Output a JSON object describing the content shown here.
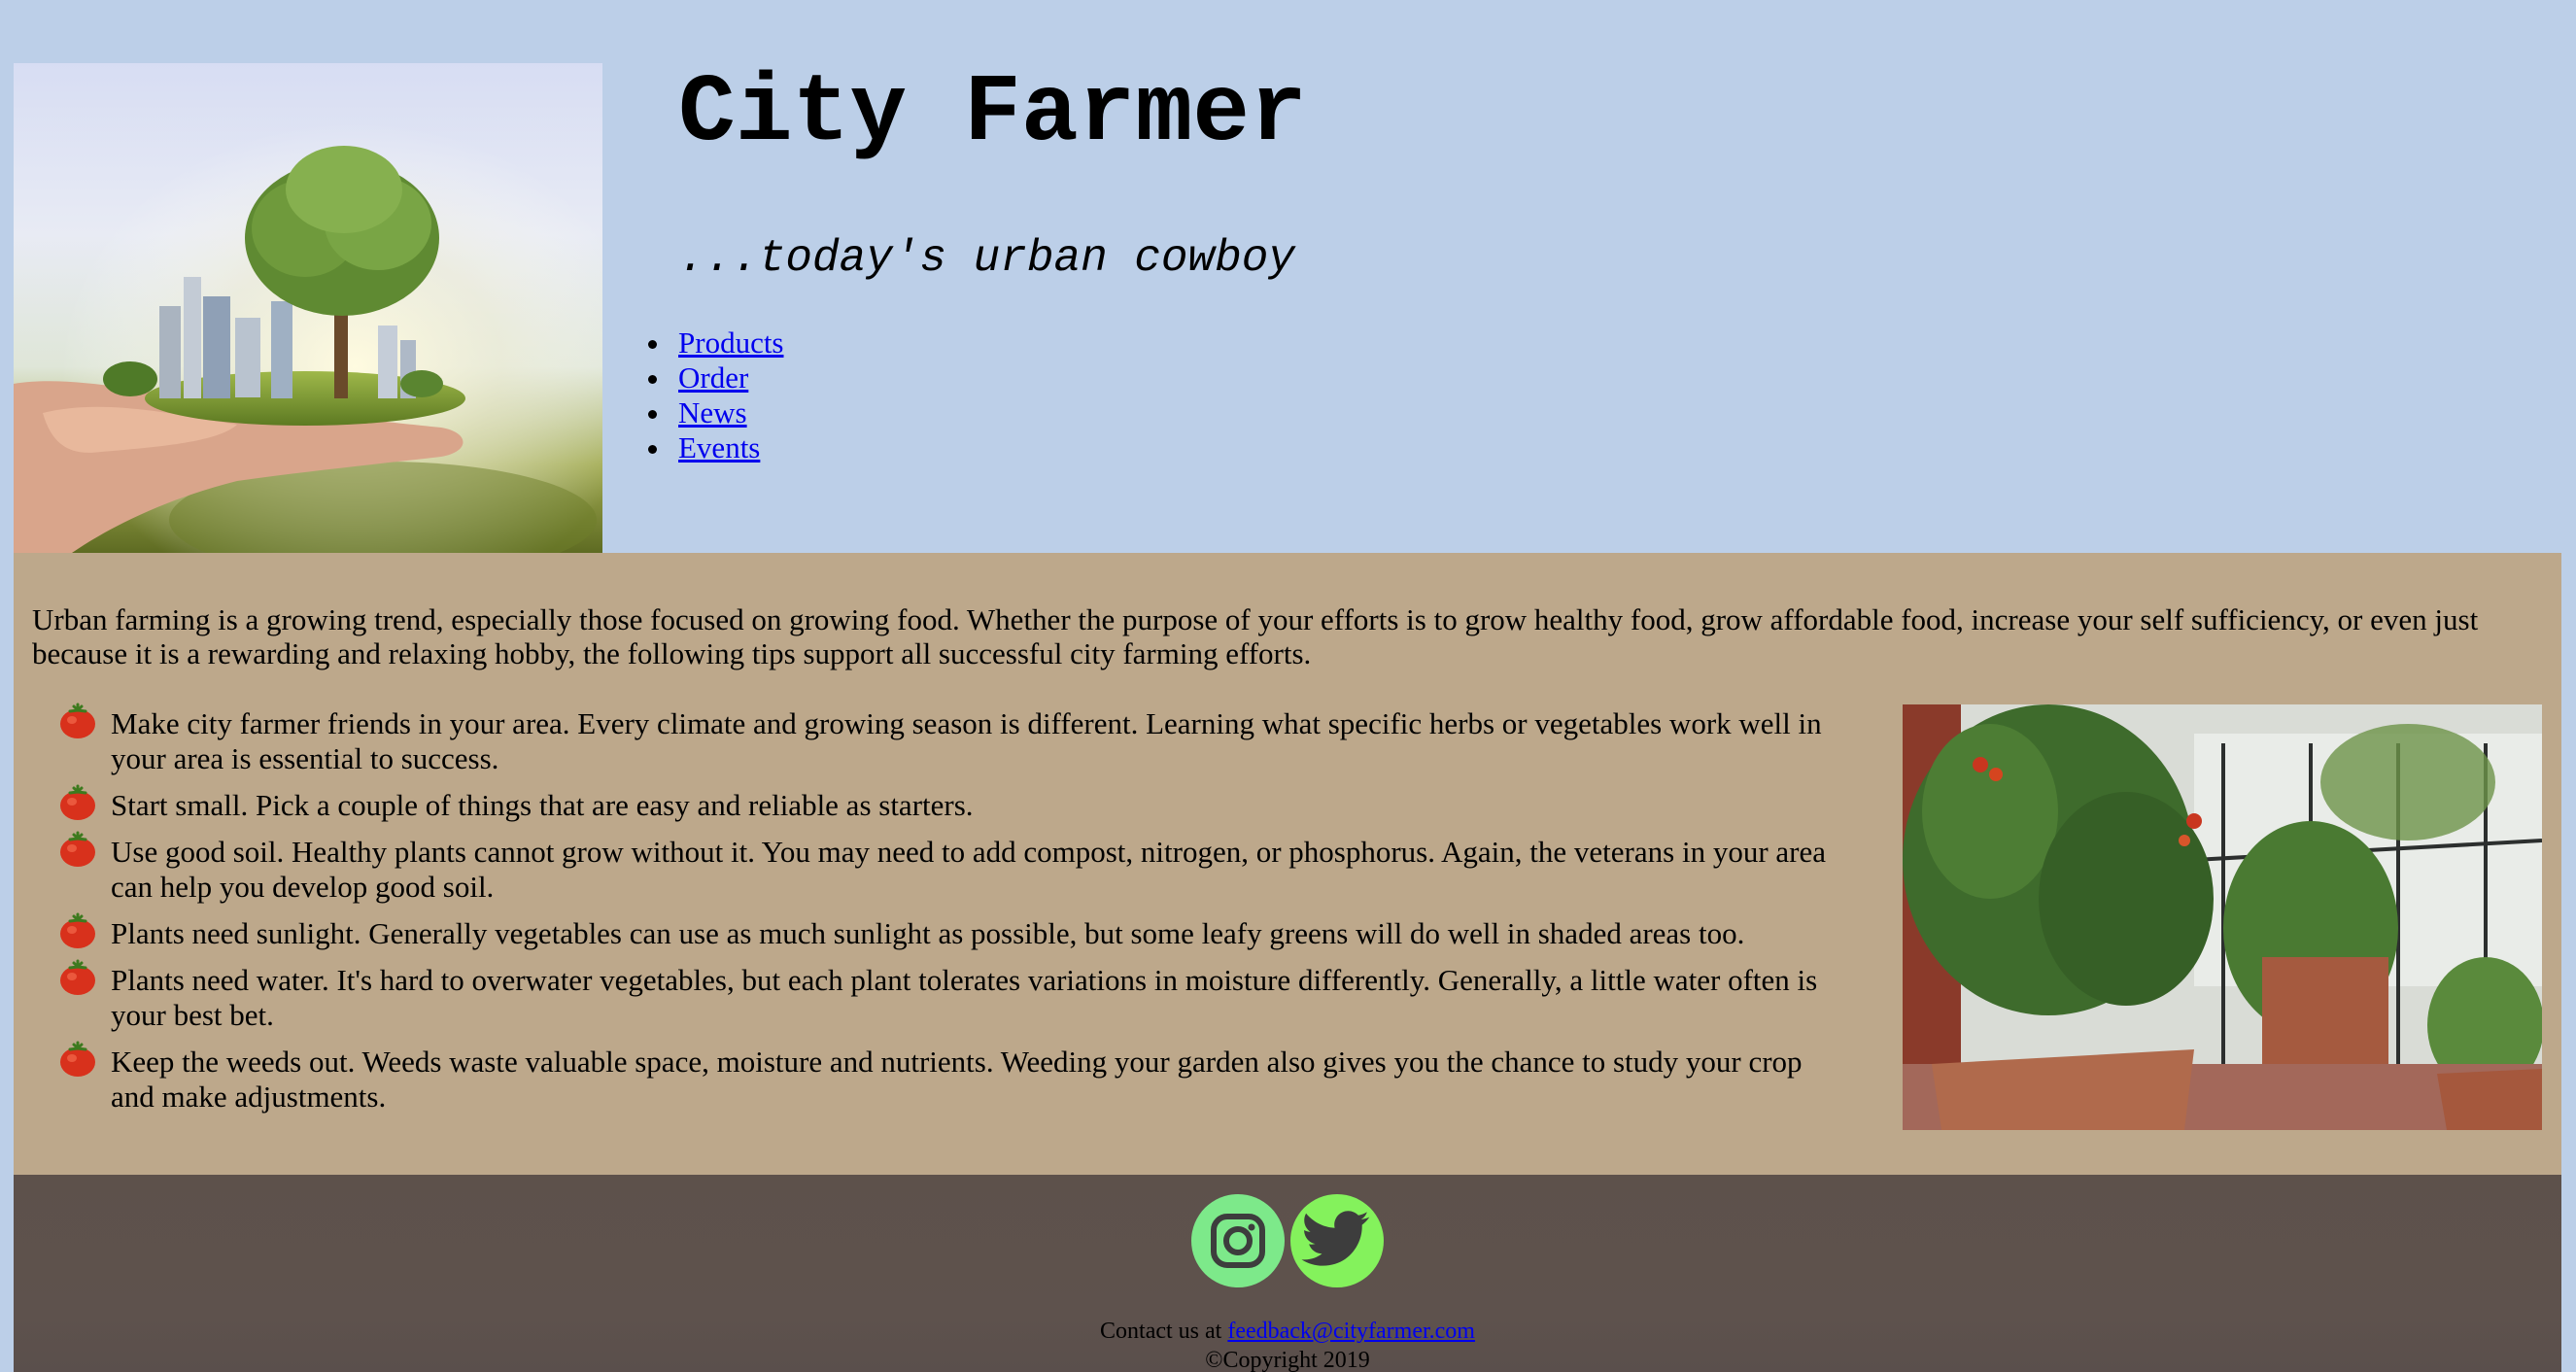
{
  "header": {
    "title": "City Farmer",
    "tagline": "...today's urban cowboy",
    "nav": [
      {
        "label": "Products"
      },
      {
        "label": "Order"
      },
      {
        "label": "News"
      },
      {
        "label": "Events"
      }
    ]
  },
  "main": {
    "intro": "Urban farming is a growing trend, especially those focused on growing food. Whether the purpose of your efforts is to grow healthy food, grow affordable food, increase your self sufficiency, or even just because it is a rewarding and relaxing hobby, the following tips support all successful city farming efforts.",
    "tips": [
      "Make city farmer friends in your area. Every climate and growing season is different. Learning what specific herbs or vegetables work well in your area is essential to success.",
      "Start small. Pick a couple of things that are easy and reliable as starters.",
      "Use good soil. Healthy plants cannot grow without it. You may need to add compost, nitrogen, or phosphorus. Again, the veterans in your area can help you develop good soil.",
      "Plants need sunlight. Generally vegetables can use as much sunlight as possible, but some leafy greens will do well in shaded areas too.",
      "Plants need water. It's hard to overwater vegetables, but each plant tolerates variations in moisture differently. Generally, a little water often is your best bet.",
      "Keep the weeds out. Weeds waste valuable space, moisture and nutrients. Weeding your garden also gives you the chance to study your crop and make adjustments."
    ],
    "bullet_icon": "tomato-icon"
  },
  "footer": {
    "social_icons": [
      "instagram-icon",
      "twitter-icon"
    ],
    "contact_prefix": "Contact us at ",
    "contact_email": "feedback@cityfarmer.com",
    "copyright": "©Copyright 2019"
  },
  "colors": {
    "page_background": "#bccfe8",
    "main_background": "#bda88b",
    "footer_background": "#5d514b",
    "instagram_button": "#7de98a",
    "twitter_button": "#84f25c",
    "link": "#0000ee"
  }
}
